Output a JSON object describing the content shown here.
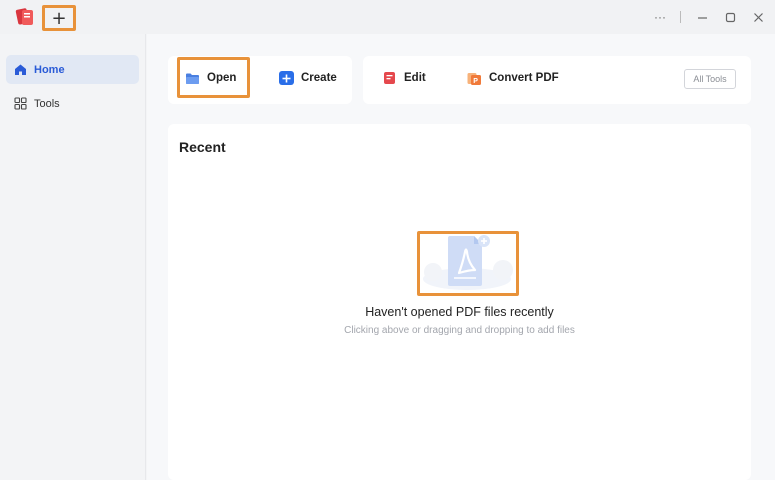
{
  "titlebar": {
    "new_tab_symbol": "+",
    "logo_icon": "app-logo-icon",
    "more_symbol": "···"
  },
  "sidebar": {
    "items": [
      {
        "label": "Home",
        "icon": "home-icon",
        "active": true
      },
      {
        "label": "Tools",
        "icon": "grid-icon",
        "active": false
      }
    ]
  },
  "toolbar": {
    "open_label": "Open",
    "create_label": "Create",
    "edit_label": "Edit",
    "convert_label": "Convert PDF",
    "all_tools_label": "All Tools"
  },
  "recent": {
    "title": "Recent",
    "empty_title": "Haven't opened PDF files recently",
    "empty_subtitle": "Clicking above or dragging and dropping to add files"
  },
  "colors": {
    "accent_blue": "#2a5bd7",
    "highlight_orange": "#e8923a",
    "edit_red": "#e5484d",
    "convert_orange": "#f07a3a"
  }
}
